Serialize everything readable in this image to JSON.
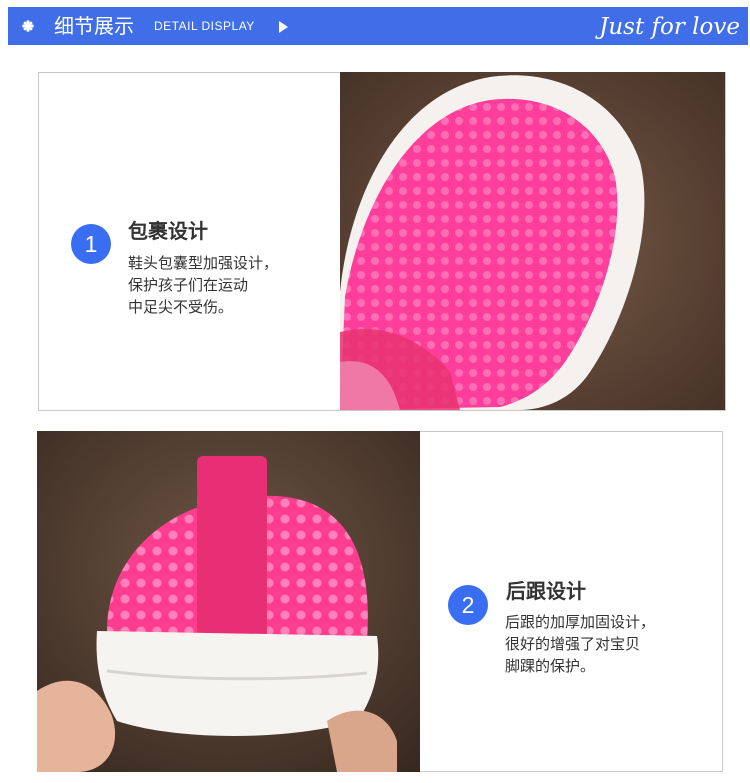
{
  "header": {
    "title_cn": "细节展示",
    "title_en": "DETAIL DISPLAY",
    "tagline": "Just for love",
    "accent_color": "#3f6ee8",
    "icons": [
      "flower-dot-icon",
      "play-arrow-icon"
    ]
  },
  "features": [
    {
      "number": "1",
      "title": "包裹设计",
      "lines": [
        "鞋头包囊型加强设计，",
        "保护孩子们在运动",
        "中足尖不受伤。"
      ]
    },
    {
      "number": "2",
      "title": "后跟设计",
      "lines": [
        "后跟的加厚加固设计，",
        "很好的增强了对宝贝",
        "脚踝的保护。"
      ]
    }
  ]
}
